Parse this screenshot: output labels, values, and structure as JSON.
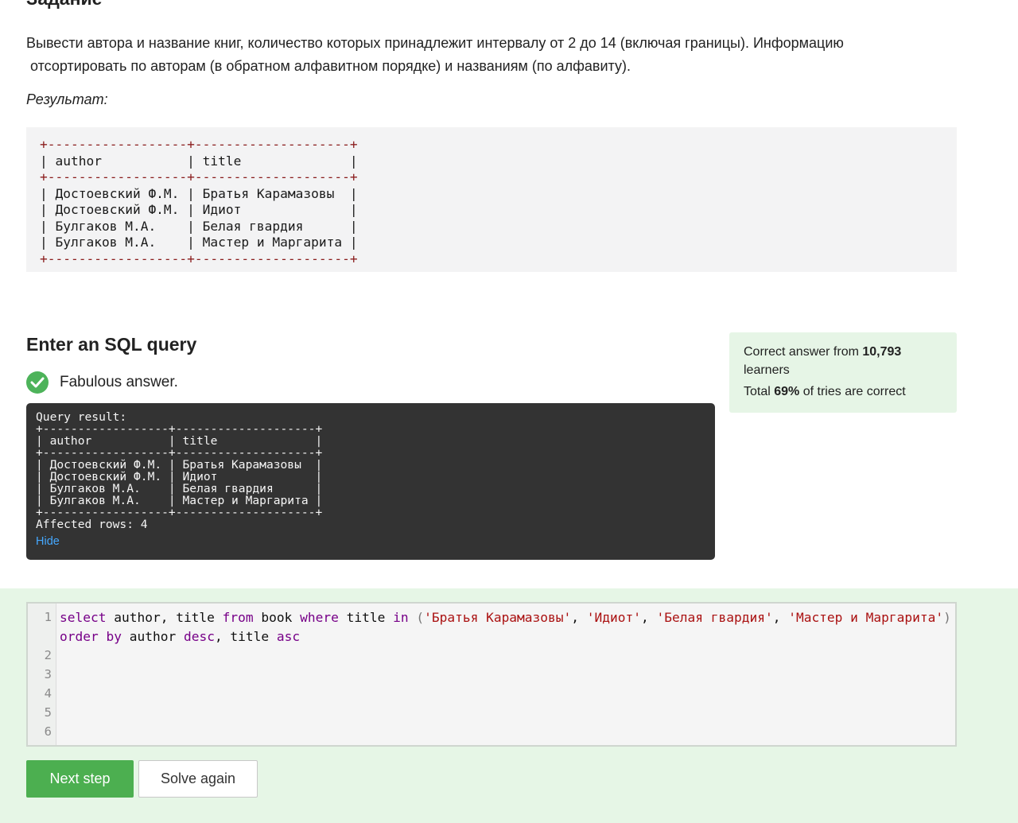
{
  "task": {
    "heading": "Задание",
    "text_line1": "Вывести  автора и название  книг, количество которых принадлежит интервалу от 2 до 14 (включая границы). Информацию",
    "text_line2": " отсортировать по авторам (в обратном алфавитном порядке) и названиям (по алфавиту).",
    "result_label": "Результат:",
    "result_table": {
      "border": "+------------------+--------------------+",
      "header": "| author           | title              |",
      "rows": [
        "| Достоевский Ф.М. | Братья Карамазовы  |",
        "| Достоевский Ф.М. | Идиот              |",
        "| Булгаков М.А.    | Белая гвардия      |",
        "| Булгаков М.А.    | Мастер и Маргарита |"
      ]
    }
  },
  "query_section": {
    "heading": "Enter an SQL query",
    "status_text": "Fabulous answer.",
    "status_icon": "check-circle-icon"
  },
  "stats": {
    "prefix": "Correct answer from ",
    "learners_count": "10,793",
    "learners_suffix": "learners",
    "total_prefix": "Total ",
    "percent": "69%",
    "total_suffix": " of tries are correct",
    "bg_color": "#e6f5e6"
  },
  "query_result": {
    "label": "Query result:",
    "border": "+------------------+--------------------+",
    "header": "| author           | title              |",
    "rows": [
      "| Достоевский Ф.М. | Братья Карамазовы  |",
      "| Достоевский Ф.М. | Идиот              |",
      "| Булгаков М.А.    | Белая гвардия      |",
      "| Булгаков М.А.    | Мастер и Маргарита |"
    ],
    "affected": "Affected rows: 4",
    "hide_label": "Hide"
  },
  "editor": {
    "line_numbers": [
      "1",
      "2",
      "3",
      "4",
      "5",
      "6"
    ],
    "tokens": {
      "select": "select",
      "cols": " author, title ",
      "from": "from",
      "tbl": " book ",
      "where": "where",
      "col": " title ",
      "in": "in",
      "sp": " ",
      "lp": "(",
      "s1": "'Братья Карамазовы'",
      "c1": ", ",
      "s2": "'Идиот'",
      "c2": ", ",
      "s3": "'Белая гвардия'",
      "c3": ", ",
      "s4": "'Мастер и Маргарита'",
      "rp": ")",
      "order": "order",
      "sp2": " ",
      "by": "by",
      "ocol1": " author ",
      "desc": "desc",
      "ocol2": ", title ",
      "asc": "asc"
    }
  },
  "buttons": {
    "next_label": "Next step",
    "again_label": "Solve again",
    "primary_color": "#4caf50"
  }
}
